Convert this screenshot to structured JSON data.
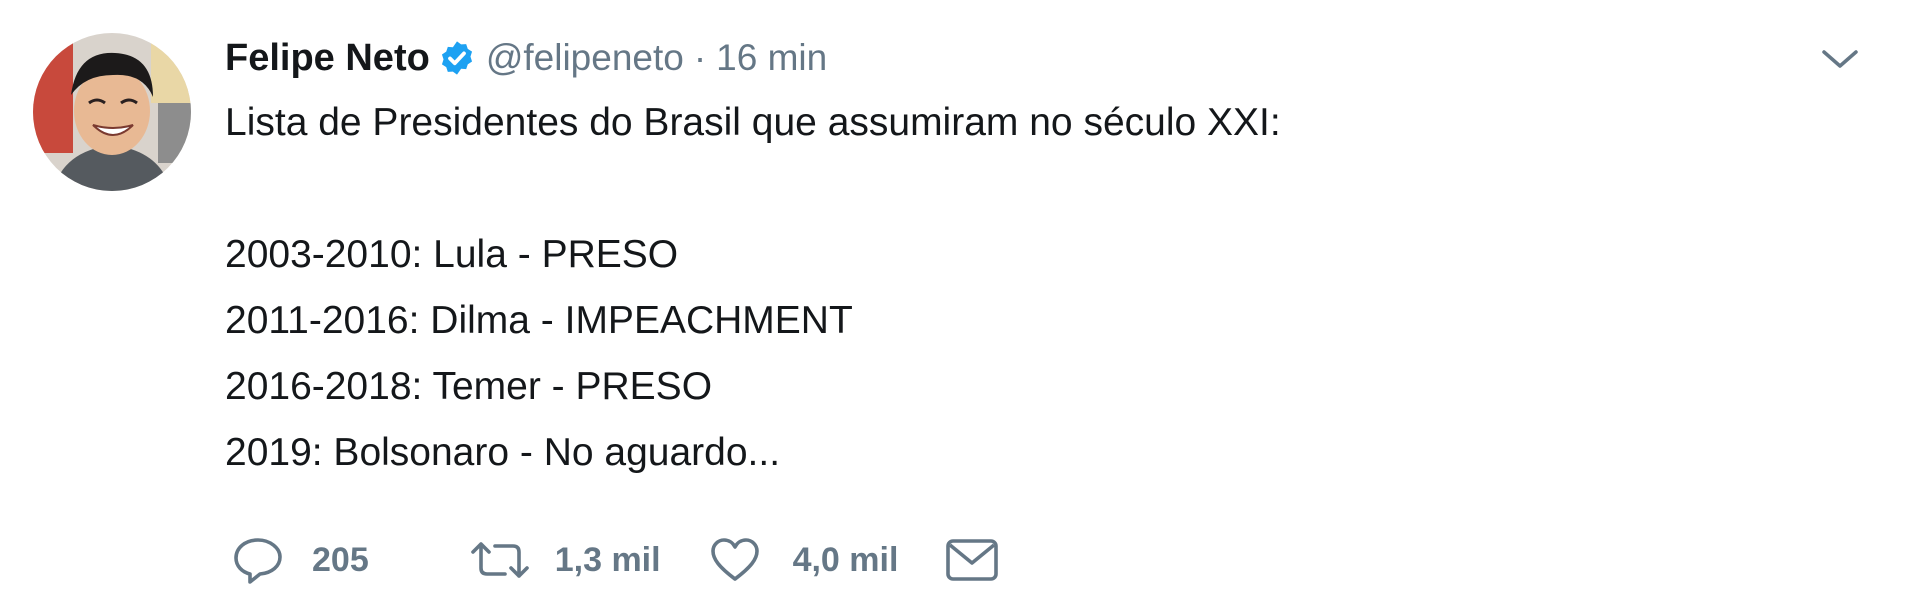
{
  "tweet": {
    "author_name": "Felipe Neto",
    "handle": "@felipeneto",
    "separator": "·",
    "time": "16 min",
    "lines": [
      "Lista de Presidentes do Brasil que assumiram no século XXI:",
      "",
      "2003-2010: Lula - PRESO",
      "2011-2016: Dilma - IMPEACHMENT",
      "2016-2018: Temer - PRESO",
      "2019: Bolsonaro - No aguardo..."
    ]
  },
  "actions": {
    "reply_count": "205",
    "retweet_count": "1,3 mil",
    "like_count": "4,0 mil"
  },
  "colors": {
    "accent": "#1da1f2",
    "muted": "#657786",
    "text": "#14171a"
  },
  "icons": {
    "verified": "verified-badge-icon",
    "caret": "chevron-down-icon",
    "reply": "reply-icon",
    "retweet": "retweet-icon",
    "like": "heart-icon",
    "dm": "envelope-icon"
  }
}
